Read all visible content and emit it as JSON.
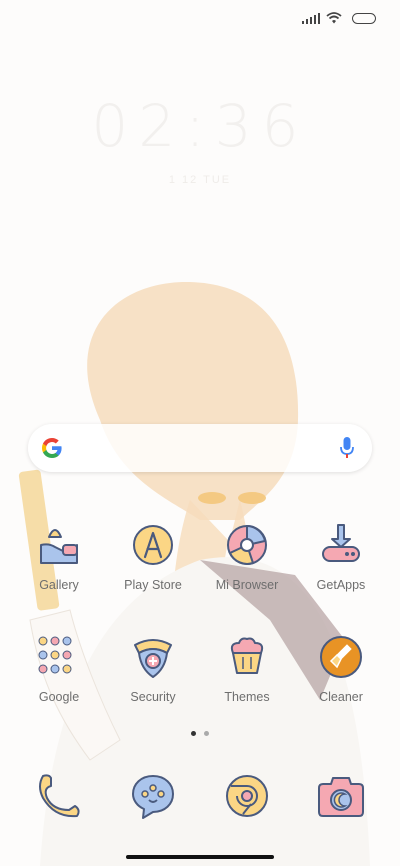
{
  "status_bar": {
    "icons": [
      "signal-icon",
      "wifi-icon",
      "battery-icon"
    ]
  },
  "clock": {
    "time": "02:36",
    "date": "1 12 TUE"
  },
  "search": {
    "logo": "google-g-icon",
    "mic_icon": "mic-icon"
  },
  "apps": [
    {
      "label": "Gallery",
      "icon": "gallery-icon"
    },
    {
      "label": "Play Store",
      "icon": "play-store-icon"
    },
    {
      "label": "Mi Browser",
      "icon": "browser-icon"
    },
    {
      "label": "GetApps",
      "icon": "getapps-icon"
    },
    {
      "label": "Google",
      "icon": "google-folder-icon"
    },
    {
      "label": "Security",
      "icon": "security-icon"
    },
    {
      "label": "Themes",
      "icon": "themes-icon"
    },
    {
      "label": "Cleaner",
      "icon": "cleaner-icon"
    }
  ],
  "dock": [
    {
      "icon": "phone-icon"
    },
    {
      "icon": "messages-icon"
    },
    {
      "icon": "chrome-icon"
    },
    {
      "icon": "camera-icon"
    }
  ],
  "pager": {
    "pages": 2,
    "active": 1
  },
  "colors": {
    "outline": "#4a5a7e",
    "blue": "#aac4ec",
    "yellow": "#fbd685",
    "pink": "#f5a8b2",
    "orange": "#e89325"
  }
}
